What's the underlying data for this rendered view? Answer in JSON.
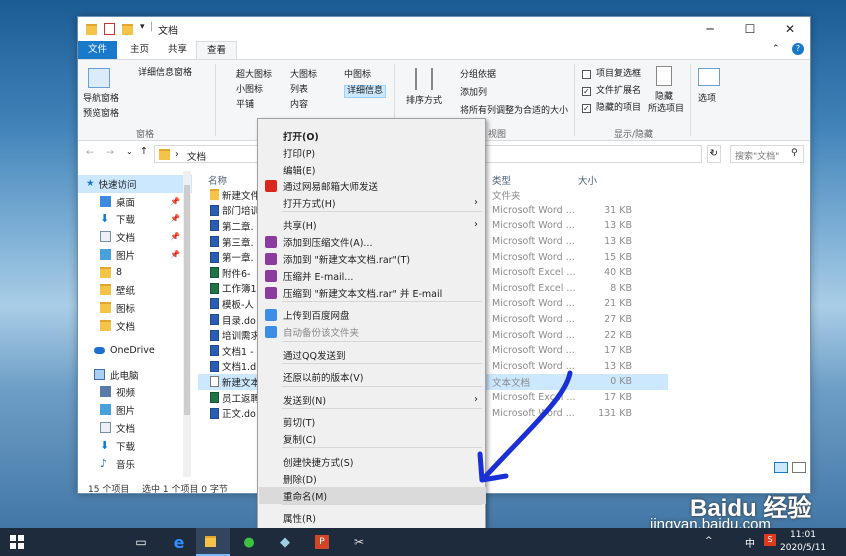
{
  "window": {
    "title": "文档"
  },
  "tabs": {
    "file": "文件",
    "home": "主页",
    "share": "共享",
    "view": "查看"
  },
  "ribbon": {
    "nav_pane": "导航窗格",
    "preview_pane": "预览窗格",
    "details_pane": "详细信息窗格",
    "panes_group": "窗格",
    "layout": {
      "xlarge": "超大图标",
      "large": "大图标",
      "medium": "中图标",
      "small": "小图标",
      "list": "列表",
      "details": "详细信息",
      "tiles": "平铺",
      "content": "内容"
    },
    "sort": "排序方式",
    "group_by": "分组依据",
    "add_column": "添加列",
    "fit_columns": "将所有列调整为合适的大小",
    "current_view_group": "视图",
    "item_checkboxes": "项目复选框",
    "file_ext": "文件扩展名",
    "hidden_items": "隐藏的项目",
    "hide": "隐藏",
    "hide_selected": "所选项目",
    "options": "选项",
    "showhide_group": "显示/隐藏"
  },
  "address": {
    "path": "文档",
    "search_placeholder": "搜索\"文档\""
  },
  "nav": {
    "quick_access": "快速访问",
    "items": [
      "桌面",
      "下载",
      "文档",
      "图片",
      "8",
      "壁纸",
      "图标",
      "文档"
    ],
    "onedrive": "OneDrive",
    "thispc": "此电脑",
    "pc_items": [
      "视频",
      "图片",
      "文档",
      "下载",
      "音乐"
    ]
  },
  "columns": {
    "name": "名称",
    "type": "类型",
    "size": "大小"
  },
  "files": [
    {
      "name": "新建文件",
      "type": "文件夹",
      "size": "",
      "kind": "folder"
    },
    {
      "name": "部门培训",
      "type": "Microsoft Word ...",
      "size": "31 KB",
      "kind": "word"
    },
    {
      "name": "第二章.",
      "type": "Microsoft Word ...",
      "size": "13 KB",
      "kind": "word"
    },
    {
      "name": "第三章.",
      "type": "Microsoft Word ...",
      "size": "13 KB",
      "kind": "word"
    },
    {
      "name": "第一章.",
      "type": "Microsoft Word ...",
      "size": "15 KB",
      "kind": "word"
    },
    {
      "name": "附件6-",
      "type": "Microsoft Excel ...",
      "size": "40 KB",
      "kind": "excel"
    },
    {
      "name": "工作簿1",
      "type": "Microsoft Excel ...",
      "size": "8 KB",
      "kind": "excel"
    },
    {
      "name": "模板-人",
      "type": "Microsoft Word ...",
      "size": "21 KB",
      "kind": "word"
    },
    {
      "name": "目录.do",
      "type": "Microsoft Word ...",
      "size": "27 KB",
      "kind": "word"
    },
    {
      "name": "培训需求",
      "type": "Microsoft Word ...",
      "size": "22 KB",
      "kind": "word"
    },
    {
      "name": "文档1 -",
      "type": "Microsoft Word ...",
      "size": "17 KB",
      "kind": "word"
    },
    {
      "name": "文档1.d",
      "type": "Microsoft Word ...",
      "size": "13 KB",
      "kind": "word"
    },
    {
      "name": "新建文本",
      "type": "文本文档",
      "size": "0 KB",
      "kind": "txt"
    },
    {
      "name": "员工返聘",
      "type": "Microsoft Excel ...",
      "size": "17 KB",
      "kind": "excel"
    },
    {
      "name": "正文.do",
      "type": "Microsoft Word ...",
      "size": "131 KB",
      "kind": "word"
    }
  ],
  "status": {
    "count": "15 个项目",
    "selected": "选中 1 个项目 0 字节"
  },
  "menu": [
    "打开(O)",
    "打印(P)",
    "编辑(E)",
    "通过网易邮箱大师发送",
    "打开方式(H)",
    "共享(H)",
    "添加到压缩文件(A)...",
    "添加到 \"新建文本文档.rar\"(T)",
    "压缩并 E-mail...",
    "压缩到 \"新建文本文档.rar\" 并 E-mail",
    "上传到百度网盘",
    "自动备份该文件夹",
    "通过QQ发送到",
    "还原以前的版本(V)",
    "发送到(N)",
    "剪切(T)",
    "复制(C)",
    "创建快捷方式(S)",
    "删除(D)",
    "重命名(M)",
    "属性(R)"
  ],
  "taskbar": {
    "time": "11:01",
    "date": "2020/5/11",
    "ime": "中"
  },
  "watermark": {
    "brand": "Baidu 经验",
    "url": "jingyan.baidu.com"
  },
  "colors": {
    "accent": "#1979ca",
    "selected_row": "#cce8ff",
    "menu_hover": "#dadada",
    "annotation": "#1a2fd4"
  }
}
